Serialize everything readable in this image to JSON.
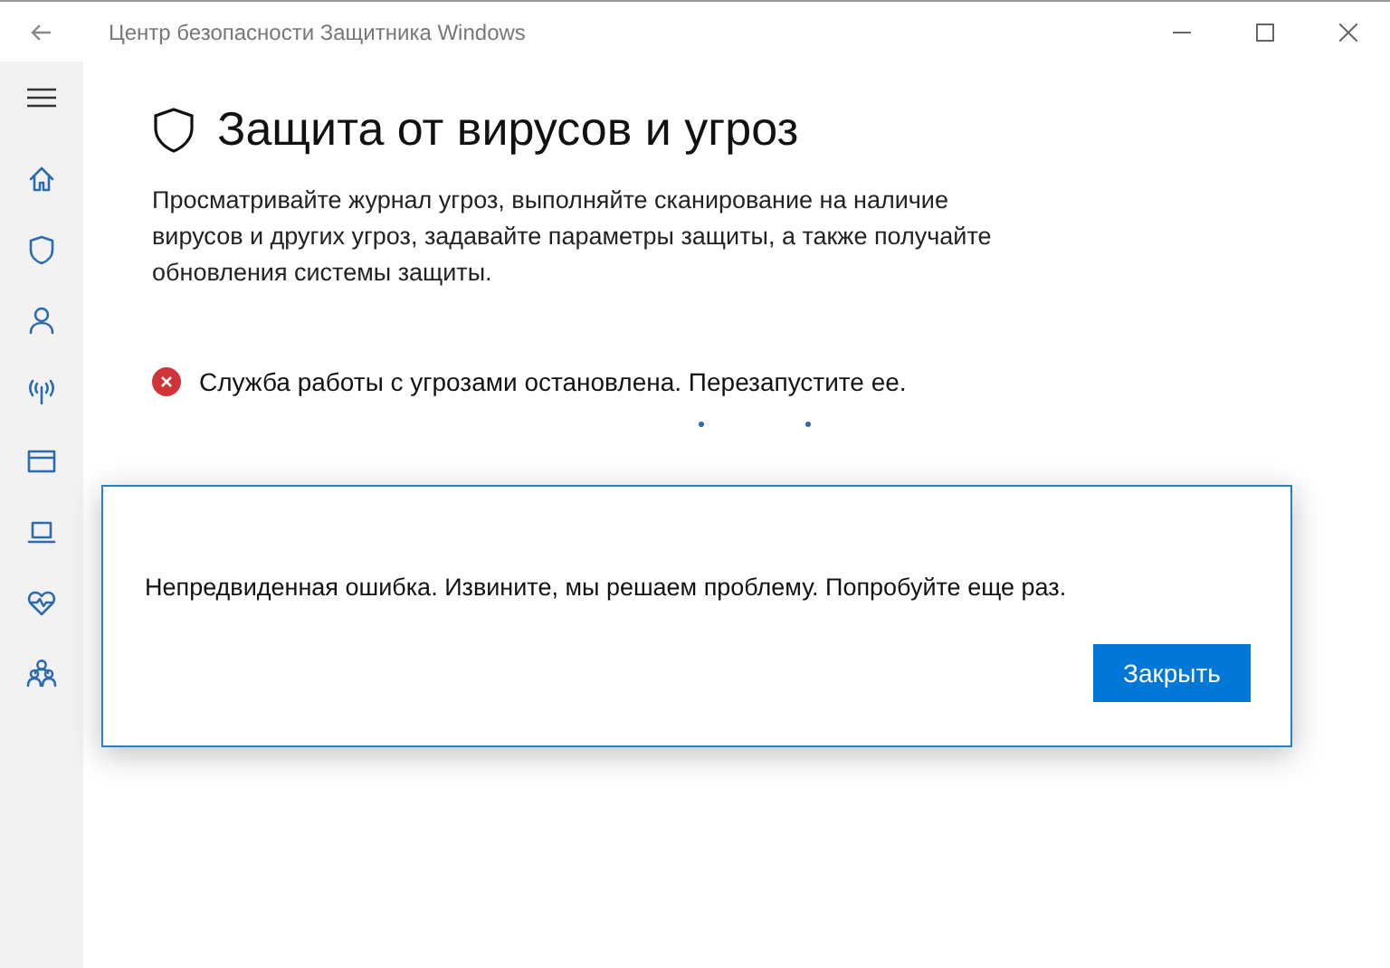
{
  "window": {
    "title": "Центр безопасности Защитника Windows"
  },
  "sidebar": {
    "items": [
      {
        "kind": "home"
      },
      {
        "kind": "shield"
      },
      {
        "kind": "person"
      },
      {
        "kind": "antenna"
      },
      {
        "kind": "browser"
      },
      {
        "kind": "laptop"
      },
      {
        "kind": "heart"
      },
      {
        "kind": "family"
      }
    ]
  },
  "page": {
    "title": "Защита от вирусов и угроз",
    "description": "Просматривайте журнал угроз, выполняйте сканирование на наличие вирусов и других угроз, задавайте параметры защиты, а также получайте обновления системы защиты.",
    "error": "Служба работы с угрозами остановлена. Перезапустите ее."
  },
  "dialog": {
    "message": "Непредвиденная ошибка. Извините, мы решаем проблему. Попробуйте еще раз.",
    "button": "Закрыть"
  }
}
